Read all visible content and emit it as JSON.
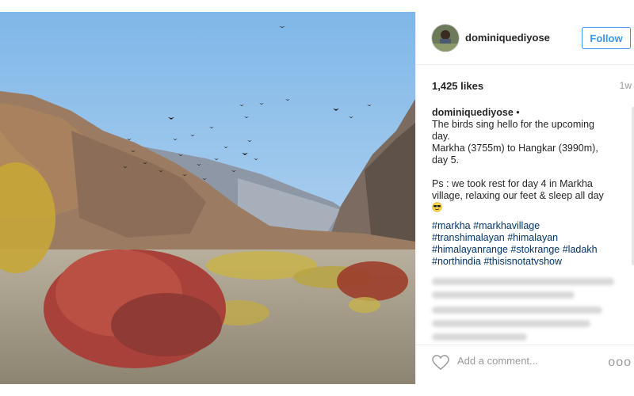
{
  "post": {
    "username": "dominiquediyose",
    "follow_label": "Follow",
    "likes": "1,425 likes",
    "time": "1w"
  },
  "caption": {
    "user": "dominiquediyose",
    "separator": "•",
    "text": "The birds sing hello for the upcoming day.\nMarkha (3755m) to Hangkar (3990m), day 5.\n\nPs : we took rest for day 4 in Markha village, relaxing our feet & sleep all day",
    "emoji": "sunglasses-smiley-icon",
    "hashtags": [
      "#markha",
      "#markhavillage",
      "#transhimalayan",
      "#himalayan",
      "#himalayanrange",
      "#stokrange",
      "#ladakh",
      "#northindia",
      "#thisisnotatvshow"
    ]
  },
  "footer": {
    "comment_placeholder": "Add a comment...",
    "more_label": "ooo"
  },
  "colors": {
    "follow_blue": "#3897f0",
    "hashtag": "#003569",
    "sky": "#a8cdee"
  }
}
